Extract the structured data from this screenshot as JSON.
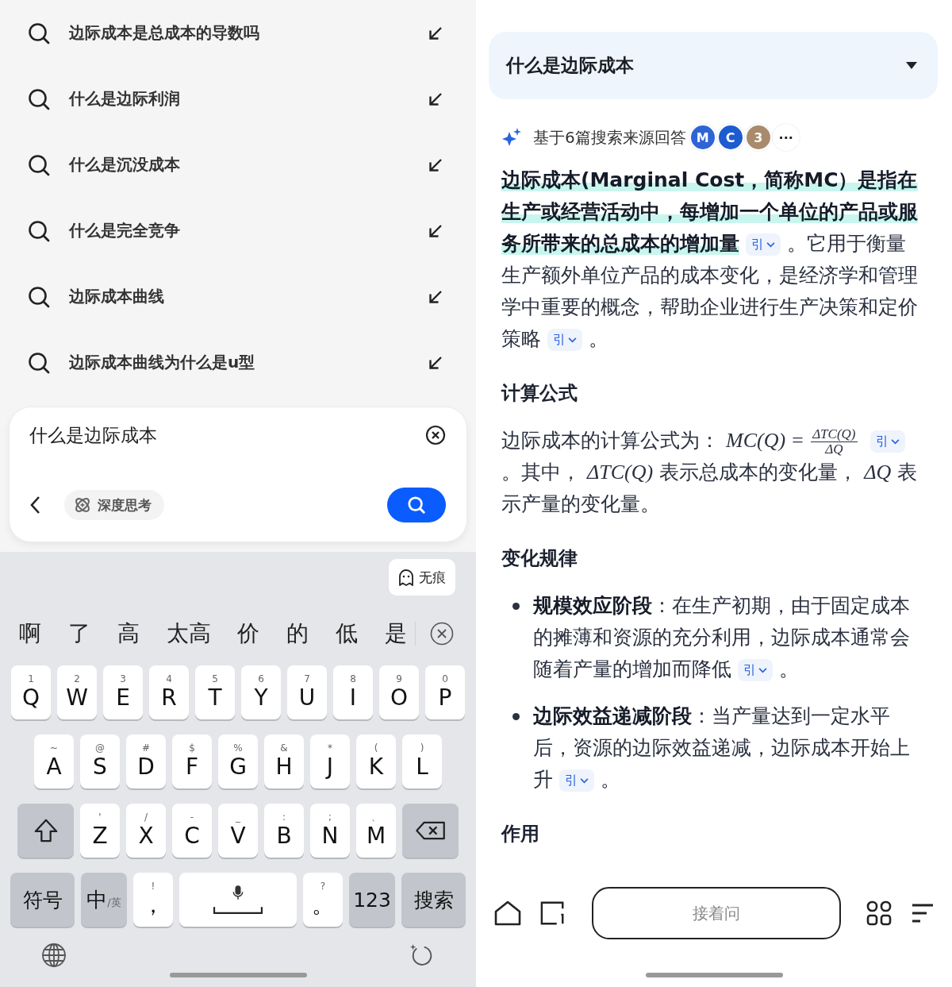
{
  "suggestions": [
    "边际成本是总成本的导数吗",
    "什么是边际利润",
    "什么是沉没成本",
    "什么是完全竞争",
    "边际成本曲线",
    "边际成本曲线为什么是u型"
  ],
  "search_box": {
    "value": "什么是边际成本",
    "deep_think": {
      "label": "深度思考",
      "on": false
    }
  },
  "incognito_button": {
    "label": "无痕"
  },
  "candidates": [
    "啊",
    "了",
    "高",
    "太高",
    "价",
    "的",
    "低",
    "是"
  ],
  "keyboard_rows": [
    [
      {
        "kind": "letter",
        "label": "Q",
        "hint": "1"
      },
      {
        "kind": "letter",
        "label": "W",
        "hint": "2"
      },
      {
        "kind": "letter",
        "label": "E",
        "hint": "3"
      },
      {
        "kind": "letter",
        "label": "R",
        "hint": "4"
      },
      {
        "kind": "letter",
        "label": "T",
        "hint": "5"
      },
      {
        "kind": "letter",
        "label": "Y",
        "hint": "6"
      },
      {
        "kind": "letter",
        "label": "U",
        "hint": "7"
      },
      {
        "kind": "letter",
        "label": "I",
        "hint": "8"
      },
      {
        "kind": "letter",
        "label": "O",
        "hint": "9"
      },
      {
        "kind": "letter",
        "label": "P",
        "hint": "0"
      }
    ],
    [
      {
        "kind": "letter",
        "label": "A",
        "hint": "~"
      },
      {
        "kind": "letter",
        "label": "S",
        "hint": "@"
      },
      {
        "kind": "letter",
        "label": "D",
        "hint": "#"
      },
      {
        "kind": "letter",
        "label": "F",
        "hint": "$"
      },
      {
        "kind": "letter",
        "label": "G",
        "hint": "%"
      },
      {
        "kind": "letter",
        "label": "H",
        "hint": "&"
      },
      {
        "kind": "letter",
        "label": "J",
        "hint": "*"
      },
      {
        "kind": "letter",
        "label": "K",
        "hint": "("
      },
      {
        "kind": "letter",
        "label": "L",
        "hint": ")"
      }
    ],
    [
      {
        "kind": "shift"
      },
      {
        "kind": "letter",
        "label": "Z",
        "hint": "'"
      },
      {
        "kind": "letter",
        "label": "X",
        "hint": "/"
      },
      {
        "kind": "letter",
        "label": "C",
        "hint": "-"
      },
      {
        "kind": "letter",
        "label": "V",
        "hint": "_"
      },
      {
        "kind": "letter",
        "label": "B",
        "hint": ":"
      },
      {
        "kind": "letter",
        "label": "N",
        "hint": ";"
      },
      {
        "kind": "letter",
        "label": "M",
        "hint": "、"
      },
      {
        "kind": "backspace"
      }
    ],
    [
      {
        "kind": "func",
        "label": "符号"
      },
      {
        "kind": "lang",
        "label": "中",
        "hint": "/英"
      },
      {
        "kind": "punct",
        "label": "，",
        "hint": "!"
      },
      {
        "kind": "space"
      },
      {
        "kind": "punct",
        "label": "。",
        "hint": "?"
      },
      {
        "kind": "func",
        "label": "123"
      },
      {
        "kind": "func",
        "label": "搜索"
      }
    ]
  ],
  "question": {
    "title": "什么是边际成本",
    "expanded": false
  },
  "sources": {
    "label": "基于6篇搜索来源回答",
    "avatars": [
      {
        "text": "M",
        "color": "#2f64d6"
      },
      {
        "text": "C",
        "color": "#1d5bd0"
      },
      {
        "text": "3",
        "color": "#a88b6d"
      },
      {
        "text": "···",
        "color": "#ffffff"
      }
    ]
  },
  "answer": [
    {
      "kind": "paragraph",
      "segments": [
        {
          "kind": "highlight",
          "text": "边际成本(Marginal Cost，简称MC）是指在生产或经营活动中，每增加一个单位的产品或服务所带来的总成本的增加量"
        },
        {
          "kind": "cite",
          "text": "引"
        },
        {
          "kind": "text",
          "text": "。它用于衡量生产额外单位产品的成本变化，是经济学和管理学中重要的概念，帮助企业进行生产决策和定价策略"
        },
        {
          "kind": "cite",
          "text": "引"
        },
        {
          "kind": "text",
          "text": "。"
        }
      ]
    },
    {
      "kind": "heading",
      "text": "计算公式"
    },
    {
      "kind": "paragraph",
      "segments": [
        {
          "kind": "text",
          "text": "边际成本的计算公式为："
        },
        {
          "kind": "math",
          "text": "MC(Q) ="
        },
        {
          "kind": "fraction",
          "numerator": "ΔTC(Q)",
          "denominator": "ΔQ"
        },
        {
          "kind": "cite",
          "text": "引"
        },
        {
          "kind": "text",
          "text": "。其中，"
        },
        {
          "kind": "math",
          "text": "ΔTC(Q)"
        },
        {
          "kind": "text",
          "text": "表示总成本的变化量，"
        },
        {
          "kind": "math",
          "text": "ΔQ"
        },
        {
          "kind": "text",
          "text": "表示产量的变化量。"
        }
      ]
    },
    {
      "kind": "heading",
      "text": "变化规律"
    },
    {
      "kind": "bullet",
      "segments": [
        {
          "kind": "bold",
          "text": "规模效应阶段"
        },
        {
          "kind": "text",
          "text": "：在生产初期，由于固定成本的摊薄和资源的充分利用，边际成本通常会随着产量的增加而降低"
        },
        {
          "kind": "cite",
          "text": "引"
        },
        {
          "kind": "text",
          "text": "。"
        }
      ]
    },
    {
      "kind": "bullet",
      "segments": [
        {
          "kind": "bold",
          "text": "边际效益递减阶段"
        },
        {
          "kind": "text",
          "text": "：当产量达到一定水平后，资源的边际效益递减，边际成本开始上升"
        },
        {
          "kind": "cite",
          "text": "引"
        },
        {
          "kind": "text",
          "text": "。"
        }
      ]
    },
    {
      "kind": "heading",
      "text": "作用"
    }
  ],
  "follow_up": {
    "placeholder": "接着问"
  }
}
